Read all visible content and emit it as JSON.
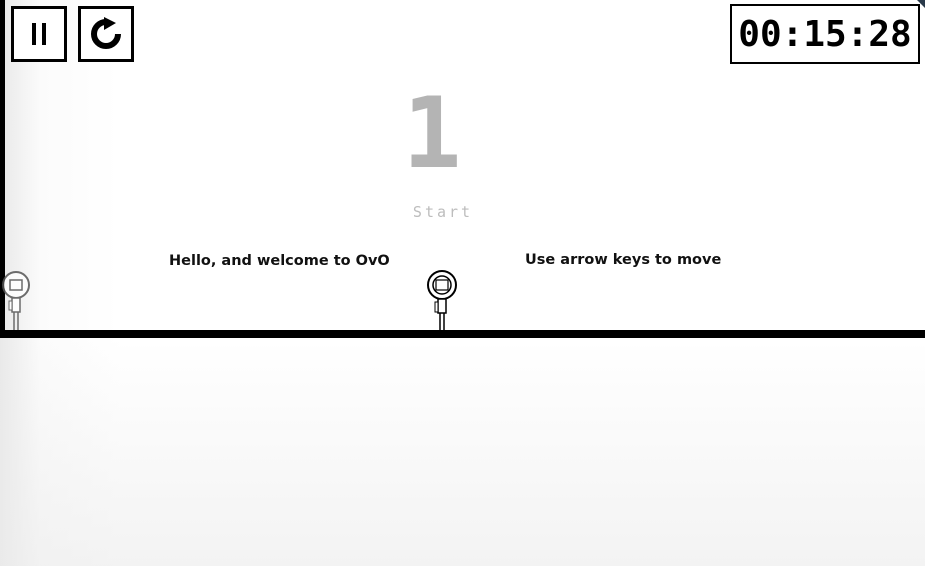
{
  "hud": {
    "pause_icon": "pause-icon",
    "restart_icon": "restart-icon",
    "timer": "00:15:28"
  },
  "level": {
    "number": "1",
    "name": "Start"
  },
  "signs": {
    "welcome": "Hello, and welcome to OvO",
    "controls": "Use arrow keys to move"
  },
  "colors": {
    "ground": "#000000",
    "level_number": "#b4b4b4",
    "level_name": "#bdbdbd",
    "background": "#ffffff"
  }
}
